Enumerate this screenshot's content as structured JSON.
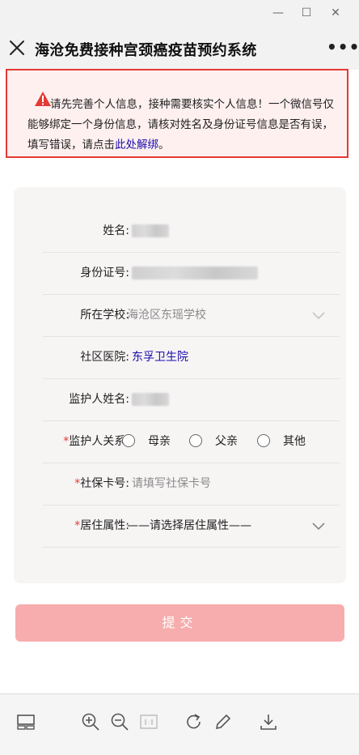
{
  "window": {
    "minimize": "—",
    "maximize": "☐",
    "close": "✕"
  },
  "nav": {
    "title": "海沧免费接种宫颈癌疫苗预约系统",
    "more": "•••"
  },
  "notice": {
    "text": "请先完善个人信息，接种需要核实个人信息！一个微信号仅能够绑定一个身份信息，请核对姓名及身份证号信息是否有误，填写错误，请点击",
    "link": "此处解绑",
    "tail": "。"
  },
  "form": {
    "name_label": "姓名:",
    "id_label": "身份证号:",
    "school_label": "所在学校:",
    "school_value": "海沧区东瑶学校",
    "hospital_label": "社区医院:",
    "hospital_value": "东孚卫生院",
    "guardian_label": "监护人姓名:",
    "relation_label": "监护人关系:",
    "relation_options": [
      "母亲",
      "父亲",
      "其他"
    ],
    "social_label": "社保卡号:",
    "social_placeholder": "请填写社保卡号",
    "residence_label": "居住属性:",
    "residence_value": "——请选择居住属性——",
    "required_mark": "*"
  },
  "submit_label": "提交",
  "colors": {
    "required": "#e53935",
    "link": "#1a0dab",
    "submit_bg": "#f7adad",
    "notice_border": "#e53935"
  },
  "toolbar": {
    "icons": [
      "layout-icon",
      "zoom-in-icon",
      "zoom-out-icon",
      "actual-size-icon",
      "rotate-icon",
      "edit-icon",
      "download-icon"
    ]
  }
}
